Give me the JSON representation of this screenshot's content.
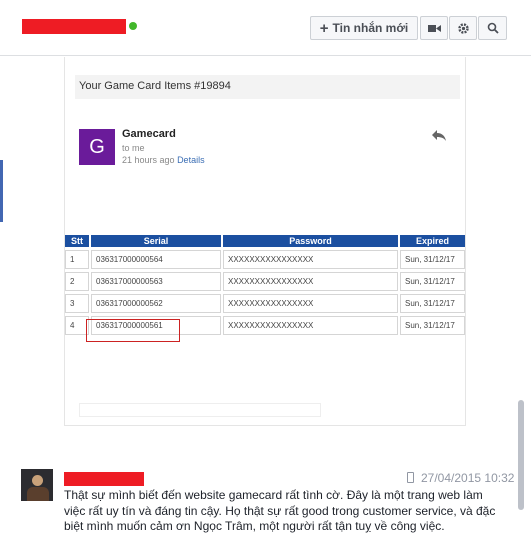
{
  "header": {
    "new_message_label": "Tin nhắn mới",
    "new_message_icon": "plus-icon",
    "video_icon": "video-camera-icon",
    "settings_icon": "gear-icon",
    "search_icon": "search-icon",
    "online_color": "#42b72a"
  },
  "email": {
    "subject": "Your Game Card Items #19894",
    "sender": "Gamecard",
    "avatar_letter": "G",
    "to": "to me",
    "time": "21 hours ago",
    "details_link": "Details",
    "table": {
      "headers": [
        "Stt",
        "Serial",
        "Password",
        "Expired"
      ],
      "rows": [
        [
          "1",
          "036317000000564",
          "XXXXXXXXXXXXXXXX",
          "Sun, 31/12/17"
        ],
        [
          "2",
          "036317000000563",
          "XXXXXXXXXXXXXXXX",
          "Sun, 31/12/17"
        ],
        [
          "3",
          "036317000000562",
          "XXXXXXXXXXXXXXXX",
          "Sun, 31/12/17"
        ],
        [
          "4",
          "036317000000561",
          "XXXXXXXXXXXXXXXX",
          "Sun, 31/12/17"
        ]
      ]
    }
  },
  "comment": {
    "date": "27/04/2015 10:32",
    "text": "Thật sự mình biết đến website gamecard rất tình cờ. Đây là một trang web làm việc rất uy tín và đáng tin cậy. Họ thật sự rất good trong customer service, và đặc biệt mình muốn cảm ơn Ngọc Trâm, một người rất tận tuỵ về công việc."
  }
}
